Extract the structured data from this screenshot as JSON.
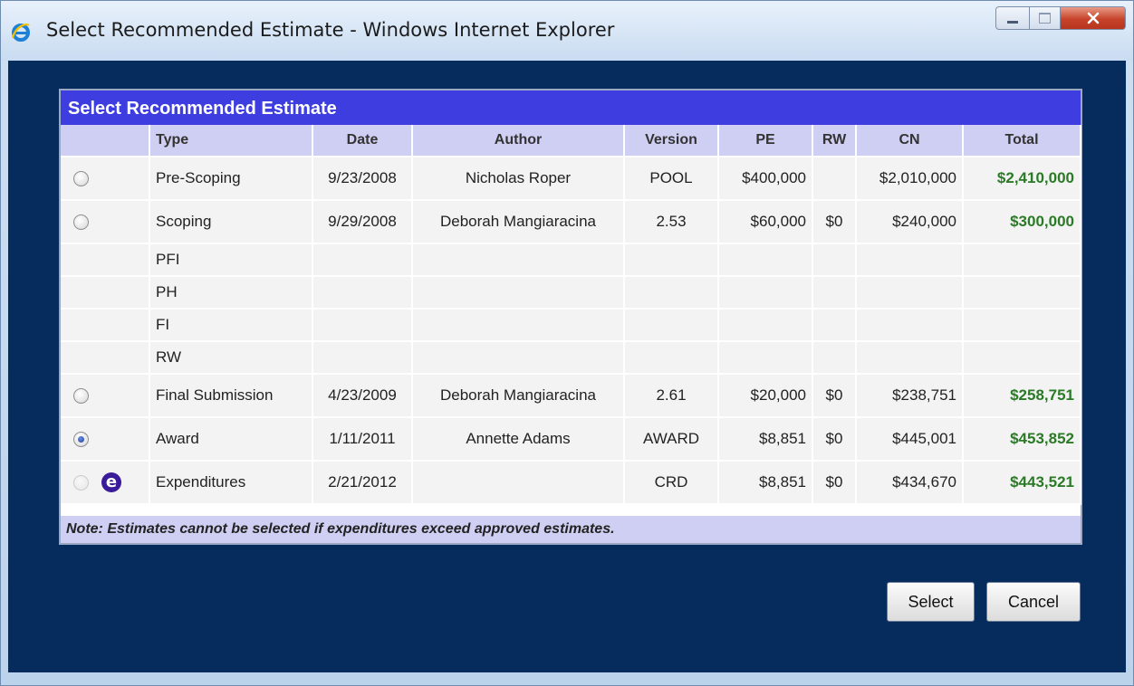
{
  "window": {
    "title": "Select Recommended Estimate - Windows Internet Explorer",
    "icon": "ie-icon",
    "controls": [
      "minimize-icon",
      "maximize-icon",
      "close-icon"
    ],
    "accent": "#3d3de0",
    "client_bg": "#062b5d"
  },
  "panel": {
    "title": "Select Recommended Estimate",
    "columns": [
      "",
      "Type",
      "Date",
      "Author",
      "Version",
      "PE",
      "RW",
      "CN",
      "Total"
    ],
    "rows": [
      {
        "selectable": true,
        "selected": false,
        "type": "Pre-Scoping",
        "date": "9/23/2008",
        "author": "Nicholas Roper",
        "version": "POOL",
        "pe": "$400,000",
        "rw": "",
        "cn": "$2,010,000",
        "total": "$2,410,000"
      },
      {
        "selectable": true,
        "selected": false,
        "type": "Scoping",
        "date": "9/29/2008",
        "author": "Deborah Mangiaracina",
        "version": "2.53",
        "pe": "$60,000",
        "rw": "$0",
        "cn": "$240,000",
        "total": "$300,000"
      },
      {
        "sub": true,
        "type": "PFI"
      },
      {
        "sub": true,
        "type": "PH"
      },
      {
        "sub": true,
        "type": "FI"
      },
      {
        "sub": true,
        "type": "RW"
      },
      {
        "selectable": true,
        "selected": false,
        "type": "Final Submission",
        "date": "4/23/2009",
        "author": "Deborah Mangiaracina",
        "version": "2.61",
        "pe": "$20,000",
        "rw": "$0",
        "cn": "$238,751",
        "total": "$258,751"
      },
      {
        "selectable": true,
        "selected": true,
        "type": "Award",
        "date": "1/11/2011",
        "author": "Annette Adams",
        "version": "AWARD",
        "pe": "$8,851",
        "rw": "$0",
        "cn": "$445,001",
        "total": "$453,852"
      },
      {
        "selectable": false,
        "selected": false,
        "icon": "e-icon",
        "icon_text": "e",
        "type": "Expenditures",
        "date": "2/21/2012",
        "author": "",
        "version": "CRD",
        "pe": "$8,851",
        "rw": "$0",
        "cn": "$434,670",
        "total": "$443,521"
      }
    ],
    "note": "Note: Estimates cannot be selected if expenditures exceed approved estimates."
  },
  "buttons": {
    "select": "Select",
    "cancel": "Cancel"
  }
}
